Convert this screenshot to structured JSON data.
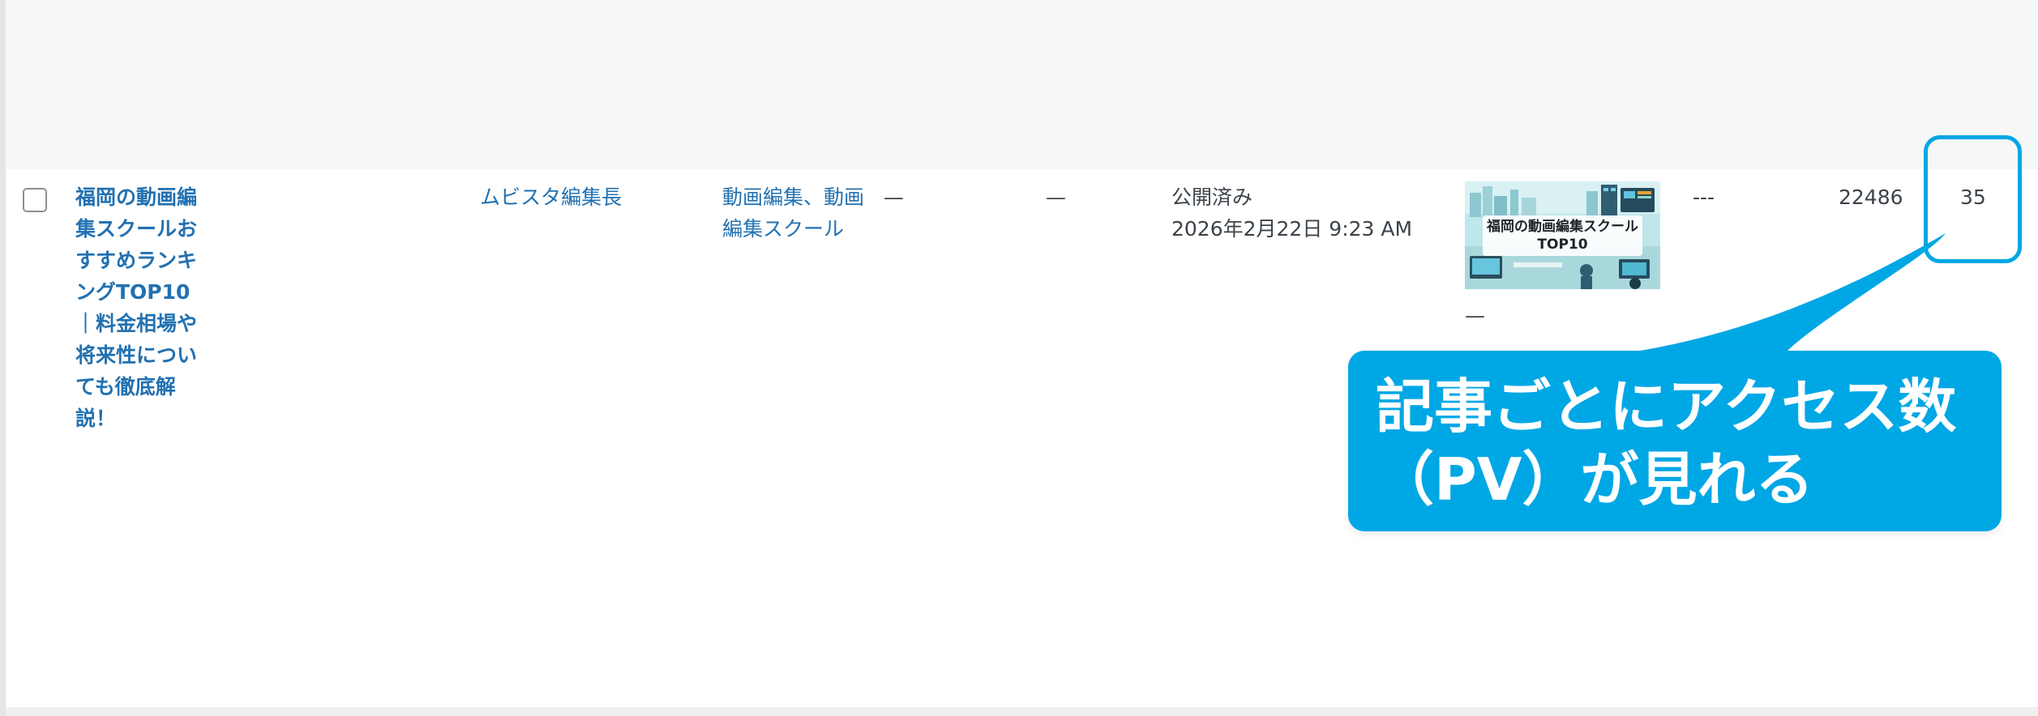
{
  "row": {
    "title": "福岡の動画編集スクールおすすめランキングTOP10｜料金相場や将来性についても徹底解説！",
    "author": "ムビスタ編集長",
    "categories": "動画編集、動画編集スクール",
    "tags": "—",
    "comments": "—",
    "status": "公開済み",
    "datetime": "2026年2月22日 9:23 AM",
    "thumbnail_caption_line1": "福岡の動画編集スクール",
    "thumbnail_caption_line2": "TOP10",
    "thumbnail_sub": "—",
    "seo": "---",
    "total_views": "22486",
    "views": "35"
  },
  "callout": {
    "line1": "記事ごとにアクセス数",
    "line2": "（PV）が見れる"
  },
  "colors": {
    "link": "#2271b1",
    "text": "#3c434a",
    "accent": "#00a7e5",
    "page_bg": "#f6f7f7",
    "row_bg": "#ffffff"
  }
}
